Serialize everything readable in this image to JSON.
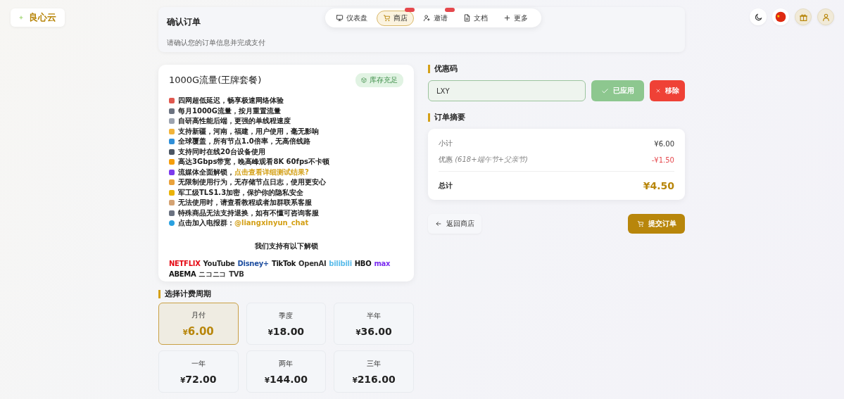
{
  "brand": {
    "name": "良心云"
  },
  "header": {
    "title": "确认订单",
    "subtitle": "请确认您的订单信息并完成支付"
  },
  "nav": [
    {
      "label": "仪表盘",
      "kind": "dashboard",
      "selected": false,
      "badge": false
    },
    {
      "label": "商店",
      "kind": "store",
      "selected": true,
      "badge": true
    },
    {
      "label": "邀请",
      "kind": "invite",
      "selected": false,
      "badge": true
    },
    {
      "label": "文档",
      "kind": "docs",
      "selected": false,
      "badge": false
    },
    {
      "label": "更多",
      "kind": "more",
      "selected": false,
      "badge": false
    }
  ],
  "product": {
    "title": "1000G流量(王牌套餐)",
    "stock": "库存充足",
    "features": [
      {
        "text": "四网超低延迟，畅享极速网络体验",
        "color": "#e0584f"
      },
      {
        "text": "每月1000G流量，按月重置流量",
        "color": "#6b7280"
      },
      {
        "text": "自研高性能后端，更强的单线程速度",
        "color": "#9ca3af"
      },
      {
        "text": "支持新疆，河南，福建，用户使用，毫无影响",
        "color": "#f2b43a"
      },
      {
        "text": "全球覆盖，所有节点1.0倍率，无高倍线路",
        "color": "#2f8fd8"
      },
      {
        "text": "支持同时在线20台设备使用",
        "color": "#4b5563"
      },
      {
        "text": "高达3Gbps带宽，晚高峰观看8K 60fps不卡顿",
        "color": "#f59e0b"
      },
      {
        "text": "流媒体全面解锁，",
        "link": "点击查看详细测试结果?",
        "color": "#7c3aed"
      },
      {
        "text": "无限制使用行为，无存储节点日志，使用更安心",
        "color": "#e9a23b"
      },
      {
        "text": "军工级TLS1.3加密，保护你的隐私安全",
        "color": "#eab308"
      },
      {
        "text": "无法使用时，请查看教程或者加群联系客服",
        "color": "#d4a373"
      },
      {
        "text": "特殊商品无法支持退换，如有不懂可咨询客服",
        "color": "#6b7280"
      },
      {
        "text": "点击加入电报群：",
        "link": "@liangxinyun_chat",
        "color": "#2aa1e0"
      }
    ]
  },
  "unlock": {
    "title": "我们支持有以下解锁",
    "services": [
      {
        "name": "NETFLIX",
        "color": "#e50914"
      },
      {
        "name": "YouTube",
        "color": "#282828"
      },
      {
        "name": "Disney+",
        "color": "#1f4fa0"
      },
      {
        "name": "TikTok",
        "color": "#111111"
      },
      {
        "name": "OpenAI",
        "color": "#333333"
      },
      {
        "name": "bilibili",
        "color": "#5bbcea"
      },
      {
        "name": "HBO",
        "color": "#111111"
      },
      {
        "name": "max",
        "color": "#7b2cf0"
      },
      {
        "name": "ABEMA",
        "color": "#111111"
      },
      {
        "name": "ニコニコ",
        "color": "#444444"
      },
      {
        "name": "TVB",
        "color": "#333333"
      }
    ]
  },
  "periods": {
    "title": "选择计费周期",
    "options": [
      {
        "label": "月付",
        "currency": "¥",
        "price": "6.00",
        "selected": true
      },
      {
        "label": "季度",
        "currency": "¥",
        "price": "18.00",
        "selected": false
      },
      {
        "label": "半年",
        "currency": "¥",
        "price": "36.00",
        "selected": false
      },
      {
        "label": "一年",
        "currency": "¥",
        "price": "72.00",
        "selected": false
      },
      {
        "label": "两年",
        "currency": "¥",
        "price": "144.00",
        "selected": false
      },
      {
        "label": "三年",
        "currency": "¥",
        "price": "216.00",
        "selected": false
      }
    ]
  },
  "coupon": {
    "title": "优惠码",
    "value": "LXY",
    "applied": "已应用",
    "remove": "移除"
  },
  "summary": {
    "title": "订单摘要",
    "rows": [
      {
        "label": "小计",
        "value": "¥6.00",
        "kind": "plain"
      },
      {
        "label": "优惠",
        "note": "(618+端午节+父亲节)",
        "value": "-¥1.50",
        "kind": "discount"
      }
    ],
    "total_label": "总计",
    "total": "¥4.50"
  },
  "actions": {
    "back": "返回商店",
    "submit": "提交订单"
  }
}
